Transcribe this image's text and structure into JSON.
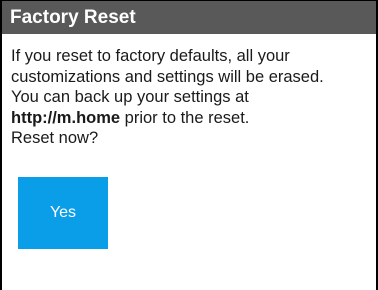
{
  "dialog": {
    "title": "Factory Reset",
    "message_line1": "If you reset to factory defaults, all your",
    "message_line2": "customizations and settings will be erased.",
    "message_line3": "You can back up your settings at",
    "backup_url": "http://m.home",
    "message_line4_suffix": " prior to the reset.",
    "question": "Reset now?",
    "yes_label": "Yes"
  },
  "colors": {
    "title_bar_bg": "#595959",
    "button_bg": "#0a9ee8"
  }
}
